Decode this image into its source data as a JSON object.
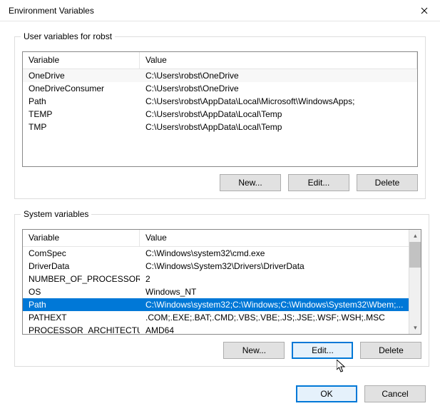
{
  "window": {
    "title": "Environment Variables"
  },
  "user_group": {
    "legend": "User variables for robst",
    "headers": {
      "variable": "Variable",
      "value": "Value"
    },
    "rows": [
      {
        "name": "OneDrive",
        "value": "C:\\Users\\robst\\OneDrive"
      },
      {
        "name": "OneDriveConsumer",
        "value": "C:\\Users\\robst\\OneDrive"
      },
      {
        "name": "Path",
        "value": "C:\\Users\\robst\\AppData\\Local\\Microsoft\\WindowsApps;"
      },
      {
        "name": "TEMP",
        "value": "C:\\Users\\robst\\AppData\\Local\\Temp"
      },
      {
        "name": "TMP",
        "value": "C:\\Users\\robst\\AppData\\Local\\Temp"
      }
    ],
    "buttons": {
      "new": "New...",
      "edit": "Edit...",
      "delete": "Delete"
    }
  },
  "system_group": {
    "legend": "System variables",
    "headers": {
      "variable": "Variable",
      "value": "Value"
    },
    "rows": [
      {
        "name": "ComSpec",
        "value": "C:\\Windows\\system32\\cmd.exe"
      },
      {
        "name": "DriverData",
        "value": "C:\\Windows\\System32\\Drivers\\DriverData"
      },
      {
        "name": "NUMBER_OF_PROCESSORS",
        "value": "2"
      },
      {
        "name": "OS",
        "value": "Windows_NT"
      },
      {
        "name": "Path",
        "value": "C:\\Windows\\system32;C:\\Windows;C:\\Windows\\System32\\Wbem;..."
      },
      {
        "name": "PATHEXT",
        "value": ".COM;.EXE;.BAT;.CMD;.VBS;.VBE;.JS;.JSE;.WSF;.WSH;.MSC"
      },
      {
        "name": "PROCESSOR_ARCHITECTURE",
        "value": "AMD64"
      }
    ],
    "selected_index": 4,
    "buttons": {
      "new": "New...",
      "edit": "Edit...",
      "delete": "Delete"
    }
  },
  "dialog_buttons": {
    "ok": "OK",
    "cancel": "Cancel"
  }
}
